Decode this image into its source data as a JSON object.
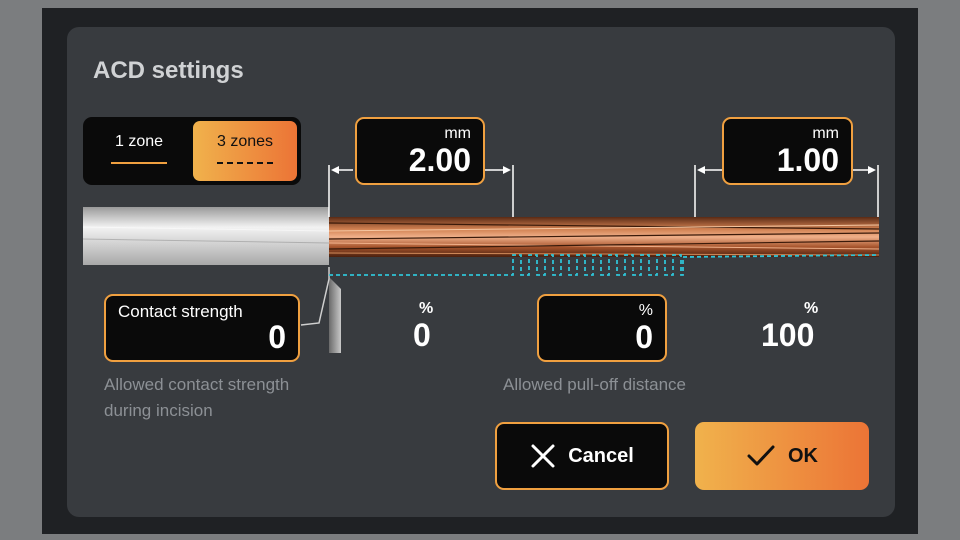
{
  "dialog": {
    "title": "ACD settings"
  },
  "zone_toggle": {
    "options": [
      {
        "label": "1 zone",
        "selected": false
      },
      {
        "label": "3 zones",
        "selected": true
      }
    ]
  },
  "dimensions": {
    "left": {
      "unit": "mm",
      "value": "2.00"
    },
    "right": {
      "unit": "mm",
      "value": "1.00"
    }
  },
  "contact_strength": {
    "label": "Contact strength",
    "value": "0",
    "hint_line1": "Allowed contact strength",
    "hint_line2": "during incision"
  },
  "pull_off": {
    "start": {
      "unit": "%",
      "value": "0"
    },
    "input": {
      "unit": "%",
      "value": "0"
    },
    "end": {
      "unit": "%",
      "value": "100"
    },
    "hint": "Allowed pull-off distance"
  },
  "buttons": {
    "cancel_label": "Cancel",
    "ok_label": "OK"
  },
  "icons": {
    "cancel": "close-icon",
    "ok": "check-icon"
  },
  "colors": {
    "accent": "#f0a040",
    "accent_gradient_start": "#f0b24c",
    "accent_gradient_end": "#ec7436",
    "dialog_bg": "#383b3f",
    "dashed_line": "#2fc3d6"
  }
}
